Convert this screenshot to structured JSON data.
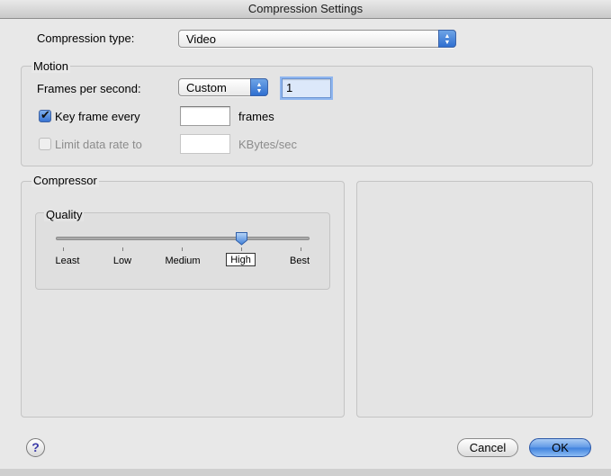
{
  "window": {
    "title": "Compression Settings"
  },
  "compression": {
    "type_label": "Compression type:",
    "type_value": "Video"
  },
  "motion": {
    "title": "Motion",
    "fps_label": "Frames per second:",
    "fps_mode": "Custom",
    "fps_value": "1",
    "keyframe_label": "Key frame every",
    "keyframe_checked": true,
    "keyframe_value": "",
    "keyframe_unit": "frames",
    "limit_label": "Limit data rate to",
    "limit_checked": false,
    "limit_value": "",
    "limit_unit": "KBytes/sec"
  },
  "compressor": {
    "title": "Compressor",
    "quality": {
      "title": "Quality",
      "levels": [
        "Least",
        "Low",
        "Medium",
        "High",
        "Best"
      ],
      "selected": "High"
    }
  },
  "buttons": {
    "help": "?",
    "cancel": "Cancel",
    "ok": "OK"
  },
  "colors": {
    "accent": "#3f81dd",
    "window_bg": "#e8e8e8"
  }
}
